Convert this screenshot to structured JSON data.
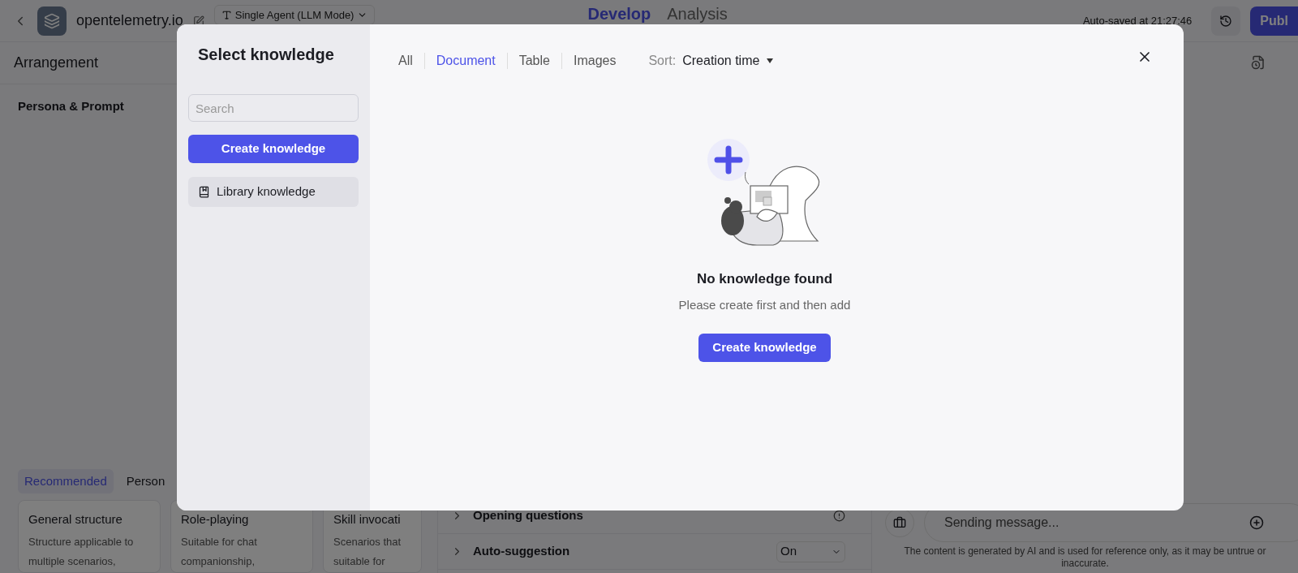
{
  "header": {
    "project": "opentelemetry.io",
    "mode": "Single Agent (LLM Mode)",
    "nav": [
      {
        "label": "Develop",
        "selected": true
      },
      {
        "label": "Analysis",
        "selected": false
      }
    ],
    "autosave": "Auto-saved at 21:27:46",
    "publish": "Publ"
  },
  "arrangement": {
    "title": "Arrangement",
    "section": "Persona & Prompt",
    "tabs": [
      {
        "label": "Recommended",
        "selected": true
      },
      {
        "label": "Person",
        "selected": false
      }
    ],
    "cards": [
      {
        "title": "General structure",
        "description": "Structure applicable to multiple scenarios,"
      },
      {
        "title": "Role-playing",
        "description": "Suitable for chat companionship,"
      },
      {
        "title": "Skill invocati",
        "description": "Scenarios that suitable for"
      }
    ]
  },
  "settings": [
    {
      "kind": "badge",
      "label": "Opening questions"
    },
    {
      "kind": "select",
      "label": "Auto-suggestion",
      "value": "On"
    }
  ],
  "chat": {
    "placeholder": "Sending message...",
    "disclaimer": "The content is generated by AI and is used for reference only, as it may be untrue or inaccurate."
  },
  "dialog": {
    "title": "Select knowledge",
    "search": {
      "placeholder": "Search"
    },
    "create": "Create knowledge",
    "sources": [
      {
        "label": "Library knowledge",
        "selected": true
      }
    ],
    "filters": [
      {
        "label": "All",
        "selected": false
      },
      {
        "label": "Document",
        "selected": true
      },
      {
        "label": "Table",
        "selected": false
      },
      {
        "label": "Images",
        "selected": false
      }
    ],
    "sort": {
      "label": "Sort:",
      "value": "Creation time"
    },
    "empty": {
      "title": "No knowledge found",
      "message": "Please create first and then add",
      "action": "Create knowledge"
    }
  }
}
